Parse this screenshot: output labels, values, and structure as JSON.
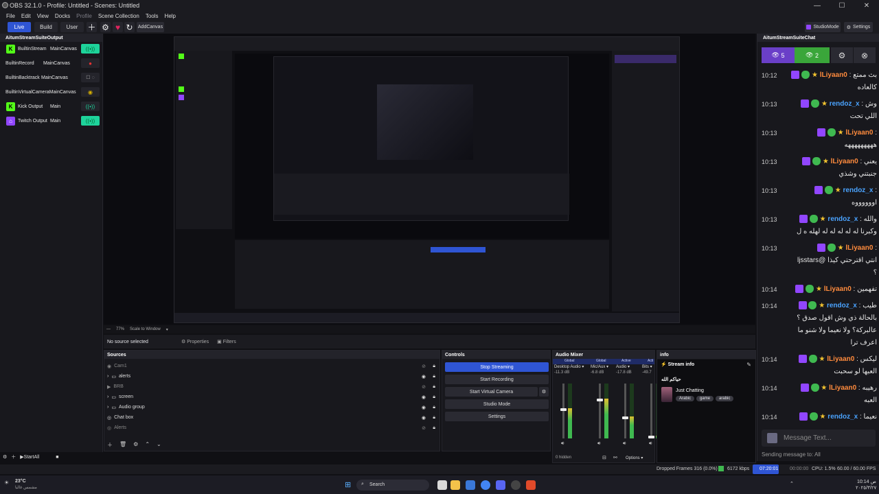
{
  "window": {
    "title": "OBS 32.1.0 - Profile: Untitled - Scenes: Untitled",
    "min": "—",
    "max": "☐",
    "close": "✕"
  },
  "menu": [
    "File",
    "Edit",
    "View",
    "Docks",
    "Profile",
    "Scene Collection",
    "Tools",
    "Help"
  ],
  "toolbar": {
    "live": "Live",
    "build": "Build",
    "user": "User",
    "add_canvas": "AddCanvas",
    "studio_mode": "StudioMode",
    "settings": "Settings"
  },
  "outputs": {
    "title": "AitumStreamSuiteOutput",
    "rows": [
      {
        "name": "BuiltinStream",
        "canvas": "MainCanvas"
      },
      {
        "name": "BuiltinRecord",
        "canvas": "MainCanvas"
      },
      {
        "name": "BuiltinBacktrack",
        "canvas": "MainCanvas"
      },
      {
        "name": "BuiltinVirtualCameraMainCanvas",
        "canvas": ""
      },
      {
        "name": "Kick Output",
        "canvas": "Main"
      },
      {
        "name": "Twitch Output",
        "canvas": "Main"
      }
    ]
  },
  "preview": {
    "zoom": "77%",
    "scale_mode": "Scale to Window"
  },
  "source_bar": {
    "selection": "No source selected",
    "properties": "Properties",
    "filters": "Filters"
  },
  "sources": {
    "title": "Sources",
    "items": [
      "Cam1",
      "alerts",
      "BRB",
      "screen",
      "Audio group",
      "Chat box",
      "Alerts"
    ]
  },
  "controls": {
    "title": "Controls",
    "stop_streaming": "Stop Streaming",
    "start_recording": "Start Recording",
    "start_virtual_camera": "Start Virtual Camera",
    "studio_mode": "Studio Mode",
    "settings": "Settings"
  },
  "source_footer": {
    "start_all": "StartAll"
  },
  "mixer": {
    "title": "Audio Mixer",
    "global1": "Global",
    "global2": "Global",
    "active1": "Active",
    "active2": "Acti",
    "channels": [
      {
        "name": "Desktop Audio",
        "db": "-11.3 dB",
        "level": 0.55
      },
      {
        "name": "Mic/Aux",
        "db": "-6.8 dB",
        "level": 0.72
      },
      {
        "name": "Audio",
        "db": "-17.8 dB",
        "level": 0.4
      },
      {
        "name": "Bits",
        "db": "-49.7",
        "level": 0.05
      }
    ],
    "hidden": "0 hidden",
    "options": "Options"
  },
  "info": {
    "title": "info",
    "stream_info": "Stream info",
    "stream_title": "حياكم الله",
    "category": "Just Chatting",
    "tags": [
      "Arabic",
      "game",
      "arabic"
    ]
  },
  "chat": {
    "title": "AitumStreamSuiteChat",
    "viewers_a": "5",
    "viewers_b": "2",
    "input_placeholder": "Message Text...",
    "sending_to": "Sending message to: All",
    "messages": [
      {
        "time": "10:12",
        "user": "lLiyaan0",
        "text": "بث ممتع",
        "text2": "كالعاده",
        "color": "u1"
      },
      {
        "time": "10:13",
        "user": "rendoz_x",
        "text": "وش",
        "text2": "اللي تحت",
        "color": "u2"
      },
      {
        "time": "10:13",
        "user": "lLiyaan0",
        "text": "",
        "text2": "هههههههههه",
        "color": "u1"
      },
      {
        "time": "10:13",
        "user": "lLiyaan0",
        "text": "يعني",
        "text2": "جنبتني وشذي",
        "color": "u1"
      },
      {
        "time": "10:13",
        "user": "rendoz_x",
        "text": "",
        "text2": "اووووووه",
        "color": "u2"
      },
      {
        "time": "10:13",
        "user": "rendoz_x",
        "text": "والله",
        "text2": "وكبرنا له له له له له لهله ه ل",
        "color": "u2"
      },
      {
        "time": "10:13",
        "user": "lLiyaan0",
        "text": "",
        "text2": "انتي اقترحتي كيذا @ljsstars",
        "text3": "؟",
        "color": "u1"
      },
      {
        "time": "10:14",
        "user": "lLiyaan0",
        "text": "تفهمين",
        "text2": "",
        "color": "u1"
      },
      {
        "time": "10:14",
        "user": "rendoz_x",
        "text": "طيب",
        "text2": "بالحالة ذي وش اقول صدق ؟",
        "text3": "عالبركة؟ ولا نعيما ولا شنو ما",
        "text4": "اعرف ترا",
        "color": "u2"
      },
      {
        "time": "10:14",
        "user": "lLiyaan0",
        "text": "ليكس",
        "text2": "العبها لو سحبت",
        "color": "u1"
      },
      {
        "time": "10:14",
        "user": "lLiyaan0",
        "text": "رهيبه",
        "text2": "العبه",
        "color": "u1"
      },
      {
        "time": "10:14",
        "user": "rendoz_x",
        "text": "نعيما",
        "text2": "",
        "color": "u2"
      }
    ]
  },
  "status": {
    "dropped": "Dropped Frames 316 (0.0%)",
    "kbps": "6172 kbps",
    "stream_time": "07:20:01",
    "rec_time": "00:00:00",
    "cpu": "CPU: 1.5%",
    "fps": "60.00 / 60.00 FPS"
  },
  "taskbar": {
    "weather_temp": "23°C",
    "weather_desc": "مشمس غالبا",
    "search": "Search",
    "time": "10:14 ص",
    "date": "٢٠٢٥/٣/٢٧"
  },
  "colors": {
    "accent": "#2f55d4",
    "kick": "#53fc18",
    "twitch": "#9146ff",
    "active_toggle": "#1ed39b"
  }
}
